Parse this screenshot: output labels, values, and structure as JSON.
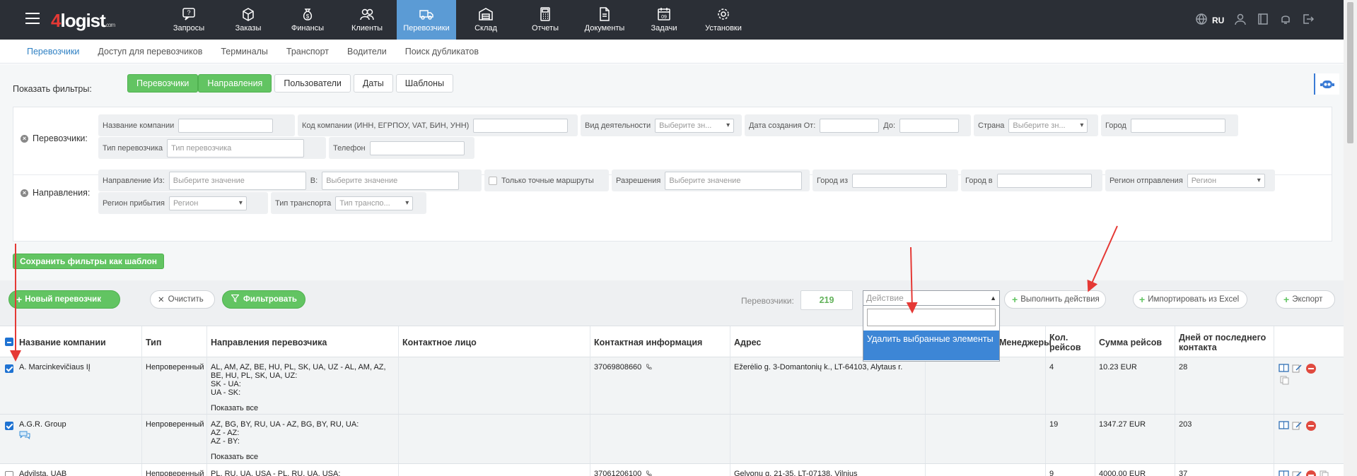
{
  "topbar": {
    "logo": {
      "num": "4",
      "text": "logist",
      "suffix": ".com"
    },
    "nav": [
      {
        "label": "Запросы",
        "icon": "question-chat-icon"
      },
      {
        "label": "Заказы",
        "icon": "box-icon"
      },
      {
        "label": "Финансы",
        "icon": "money-bag-icon"
      },
      {
        "label": "Клиенты",
        "icon": "users-icon"
      },
      {
        "label": "Перевозчики",
        "icon": "truck-icon",
        "active": true
      },
      {
        "label": "Склад",
        "icon": "warehouse-icon"
      },
      {
        "label": "Отчеты",
        "icon": "calculator-icon"
      },
      {
        "label": "Документы",
        "icon": "document-icon"
      },
      {
        "label": "Задачи",
        "icon": "calendar-icon"
      },
      {
        "label": "Установки",
        "icon": "gear-icon"
      }
    ],
    "lang": "RU"
  },
  "subnav": [
    "Перевозчики",
    "Доступ для перевозчиков",
    "Терминалы",
    "Транспорт",
    "Водители",
    "Поиск дубликатов"
  ],
  "filters": {
    "show_label": "Показать фильтры:",
    "tabs": [
      "Перевозчики",
      "Направления",
      "Пользователи",
      "Даты",
      "Шаблоны"
    ],
    "carriers_label": "Перевозчики:",
    "company_name": "Название компании",
    "company_code": "Код компании (ИНН, ЕГРПОУ, VAT, БИН, УНН)",
    "activity": "Вид деятельности",
    "select_value_short": "Выберите зн...",
    "date_from": "Дата создания От:",
    "date_to": "До:",
    "country": "Страна",
    "city": "Город",
    "carrier_type": "Тип перевозчика",
    "carrier_type_placeholder": "Тип перевозчика",
    "phone": "Телефон",
    "directions_label": "Направления:",
    "direction_from": "Направление Из:",
    "select_value": "Выберите значение",
    "to": "В:",
    "exact_routes": "Только точные маршруты",
    "permissions": "Разрешения",
    "city_from": "Город из",
    "city_to": "Город в",
    "region_departure": "Регион отправления",
    "region_placeholder": "Регион",
    "region_arrival": "Регион прибытия",
    "transport_type": "Тип транспорта",
    "transport_placeholder": "Тип транспо...",
    "save_template": "Сохранить фильтры как шаблон"
  },
  "actionbar": {
    "new_carrier": "Новый перевозчик",
    "clear": "Очистить",
    "filter": "Фильтровать",
    "count_label": "Перевозчики:",
    "count": "219",
    "action_placeholder": "Действие",
    "action_option": "Удалить выбранные элементы",
    "perform": "Выполнить действия",
    "import_excel": "Импортировать из Excel",
    "export": "Экспорт"
  },
  "table": {
    "headers": {
      "company": "Название компании",
      "type": "Тип",
      "directions": "Направления перевозчика",
      "contact": "Контактное лицо",
      "contact_info": "Контактная информация",
      "address": "Адрес",
      "managers": "Менеджеры",
      "trips": "Кол. рейсов",
      "sum": "Сумма рейсов",
      "days": "Дней от последнего контакта"
    },
    "show_all": "Показать все",
    "rows": [
      {
        "company": "A. Marcinkevičiaus IĮ",
        "type": "Непроверенный",
        "directions": [
          "AL, AM, AZ, BE, HU, PL, SK, UA, UZ - AL, AM, AZ, BE, HU, PL, SK, UA, UZ:",
          "SK - UA:",
          "UA - SK:"
        ],
        "contact": "",
        "phone": "37069808660",
        "address": "Ežerėlio g. 3-Domantonių k., LT-64103, Alytaus r.",
        "trips": "4",
        "sum": "10.23 EUR",
        "days": "28"
      },
      {
        "company": "A.G.R. Group",
        "type": "Непроверенный",
        "directions": [
          "AZ, BG, BY, RU, UA - AZ, BG, BY, RU, UA:",
          "AZ - AZ:",
          "AZ - BY:"
        ],
        "contact": "",
        "phone": "",
        "address": "",
        "trips": "19",
        "sum": "1347.27 EUR",
        "days": "203"
      },
      {
        "company": "Advilsta, UAB",
        "type": "Непроверенный",
        "directions": [
          "PL, RU, UA, USA - PL, RU, UA, USA:"
        ],
        "contact": "",
        "phone": "37061206100",
        "address": "Gelvonų g. 21-35, LT-07138, Vilnius",
        "trips": "9",
        "sum": "4000.00 EUR",
        "days": "37"
      }
    ]
  }
}
